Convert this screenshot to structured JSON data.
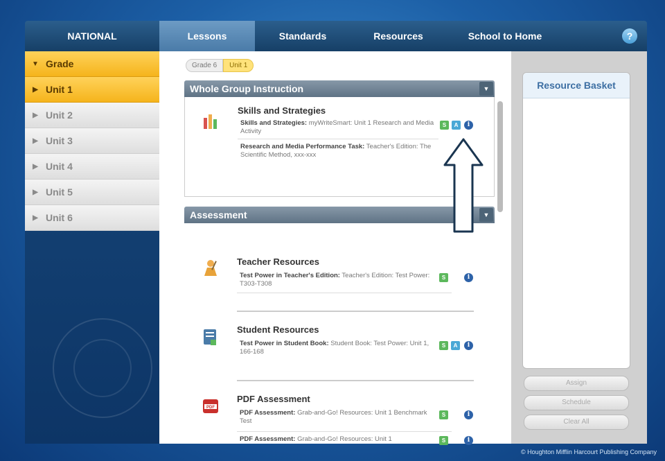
{
  "nav": {
    "brand": "NATIONAL",
    "tabs": [
      "Lessons",
      "Standards",
      "Resources",
      "School to Home"
    ],
    "active_tab": "Lessons",
    "help_label": "?"
  },
  "sidebar": {
    "items": [
      {
        "label": "Grade",
        "arrow": "▼",
        "selected": true
      },
      {
        "label": "Unit 1",
        "arrow": "▶",
        "selected": true
      },
      {
        "label": "Unit 2",
        "arrow": "▶",
        "selected": false
      },
      {
        "label": "Unit 3",
        "arrow": "▶",
        "selected": false
      },
      {
        "label": "Unit 4",
        "arrow": "▶",
        "selected": false
      },
      {
        "label": "Unit 5",
        "arrow": "▶",
        "selected": false
      },
      {
        "label": "Unit 6",
        "arrow": "▶",
        "selected": false
      }
    ]
  },
  "breadcrumb": {
    "grade": "Grade 6",
    "unit": "Unit 1"
  },
  "whole_group": {
    "title": "Whole Group Instruction",
    "resource": {
      "title": "Skills and Strategies",
      "line1_bold": "Skills and Strategies:",
      "line1_text": " myWriteSmart: Unit 1 Research and Media Activity",
      "line2_bold": "Research and Media Performance Task:",
      "line2_text": " Teacher's Edition: The Scientific Method, xxx-xxx"
    }
  },
  "assessment": {
    "title": "Assessment",
    "resources": [
      {
        "title": "Teacher Resources",
        "line_bold": "Test Power in Teacher's Edition:",
        "line_text": " Teacher's Edition: Test Power: T303-T308"
      },
      {
        "title": "Student Resources",
        "line_bold": "Test Power in Student Book:",
        "line_text": " Student Book: Test Power: Unit 1, 166-168"
      },
      {
        "title": "PDF Assessment",
        "line_bold": "PDF Assessment:",
        "line_text": " Grab-and-Go! Resources: Unit 1 Benchmark Test",
        "line2_bold": "PDF Assessment:",
        "line2_text": " Grab-and-Go! Resources: Unit 1"
      }
    ]
  },
  "badges": {
    "s": "S",
    "a": "A",
    "info": "i"
  },
  "basket": {
    "title": "Resource Basket",
    "buttons": [
      "Assign",
      "Schedule",
      "Clear All"
    ]
  },
  "footer": {
    "copyright": "© Houghton Mifflin Harcourt Publishing Company"
  },
  "colors": {
    "accent_yellow": "#f5b41c",
    "nav_blue": "#163f66",
    "badge_green": "#5cb85c",
    "badge_blue": "#4aa8d6"
  }
}
